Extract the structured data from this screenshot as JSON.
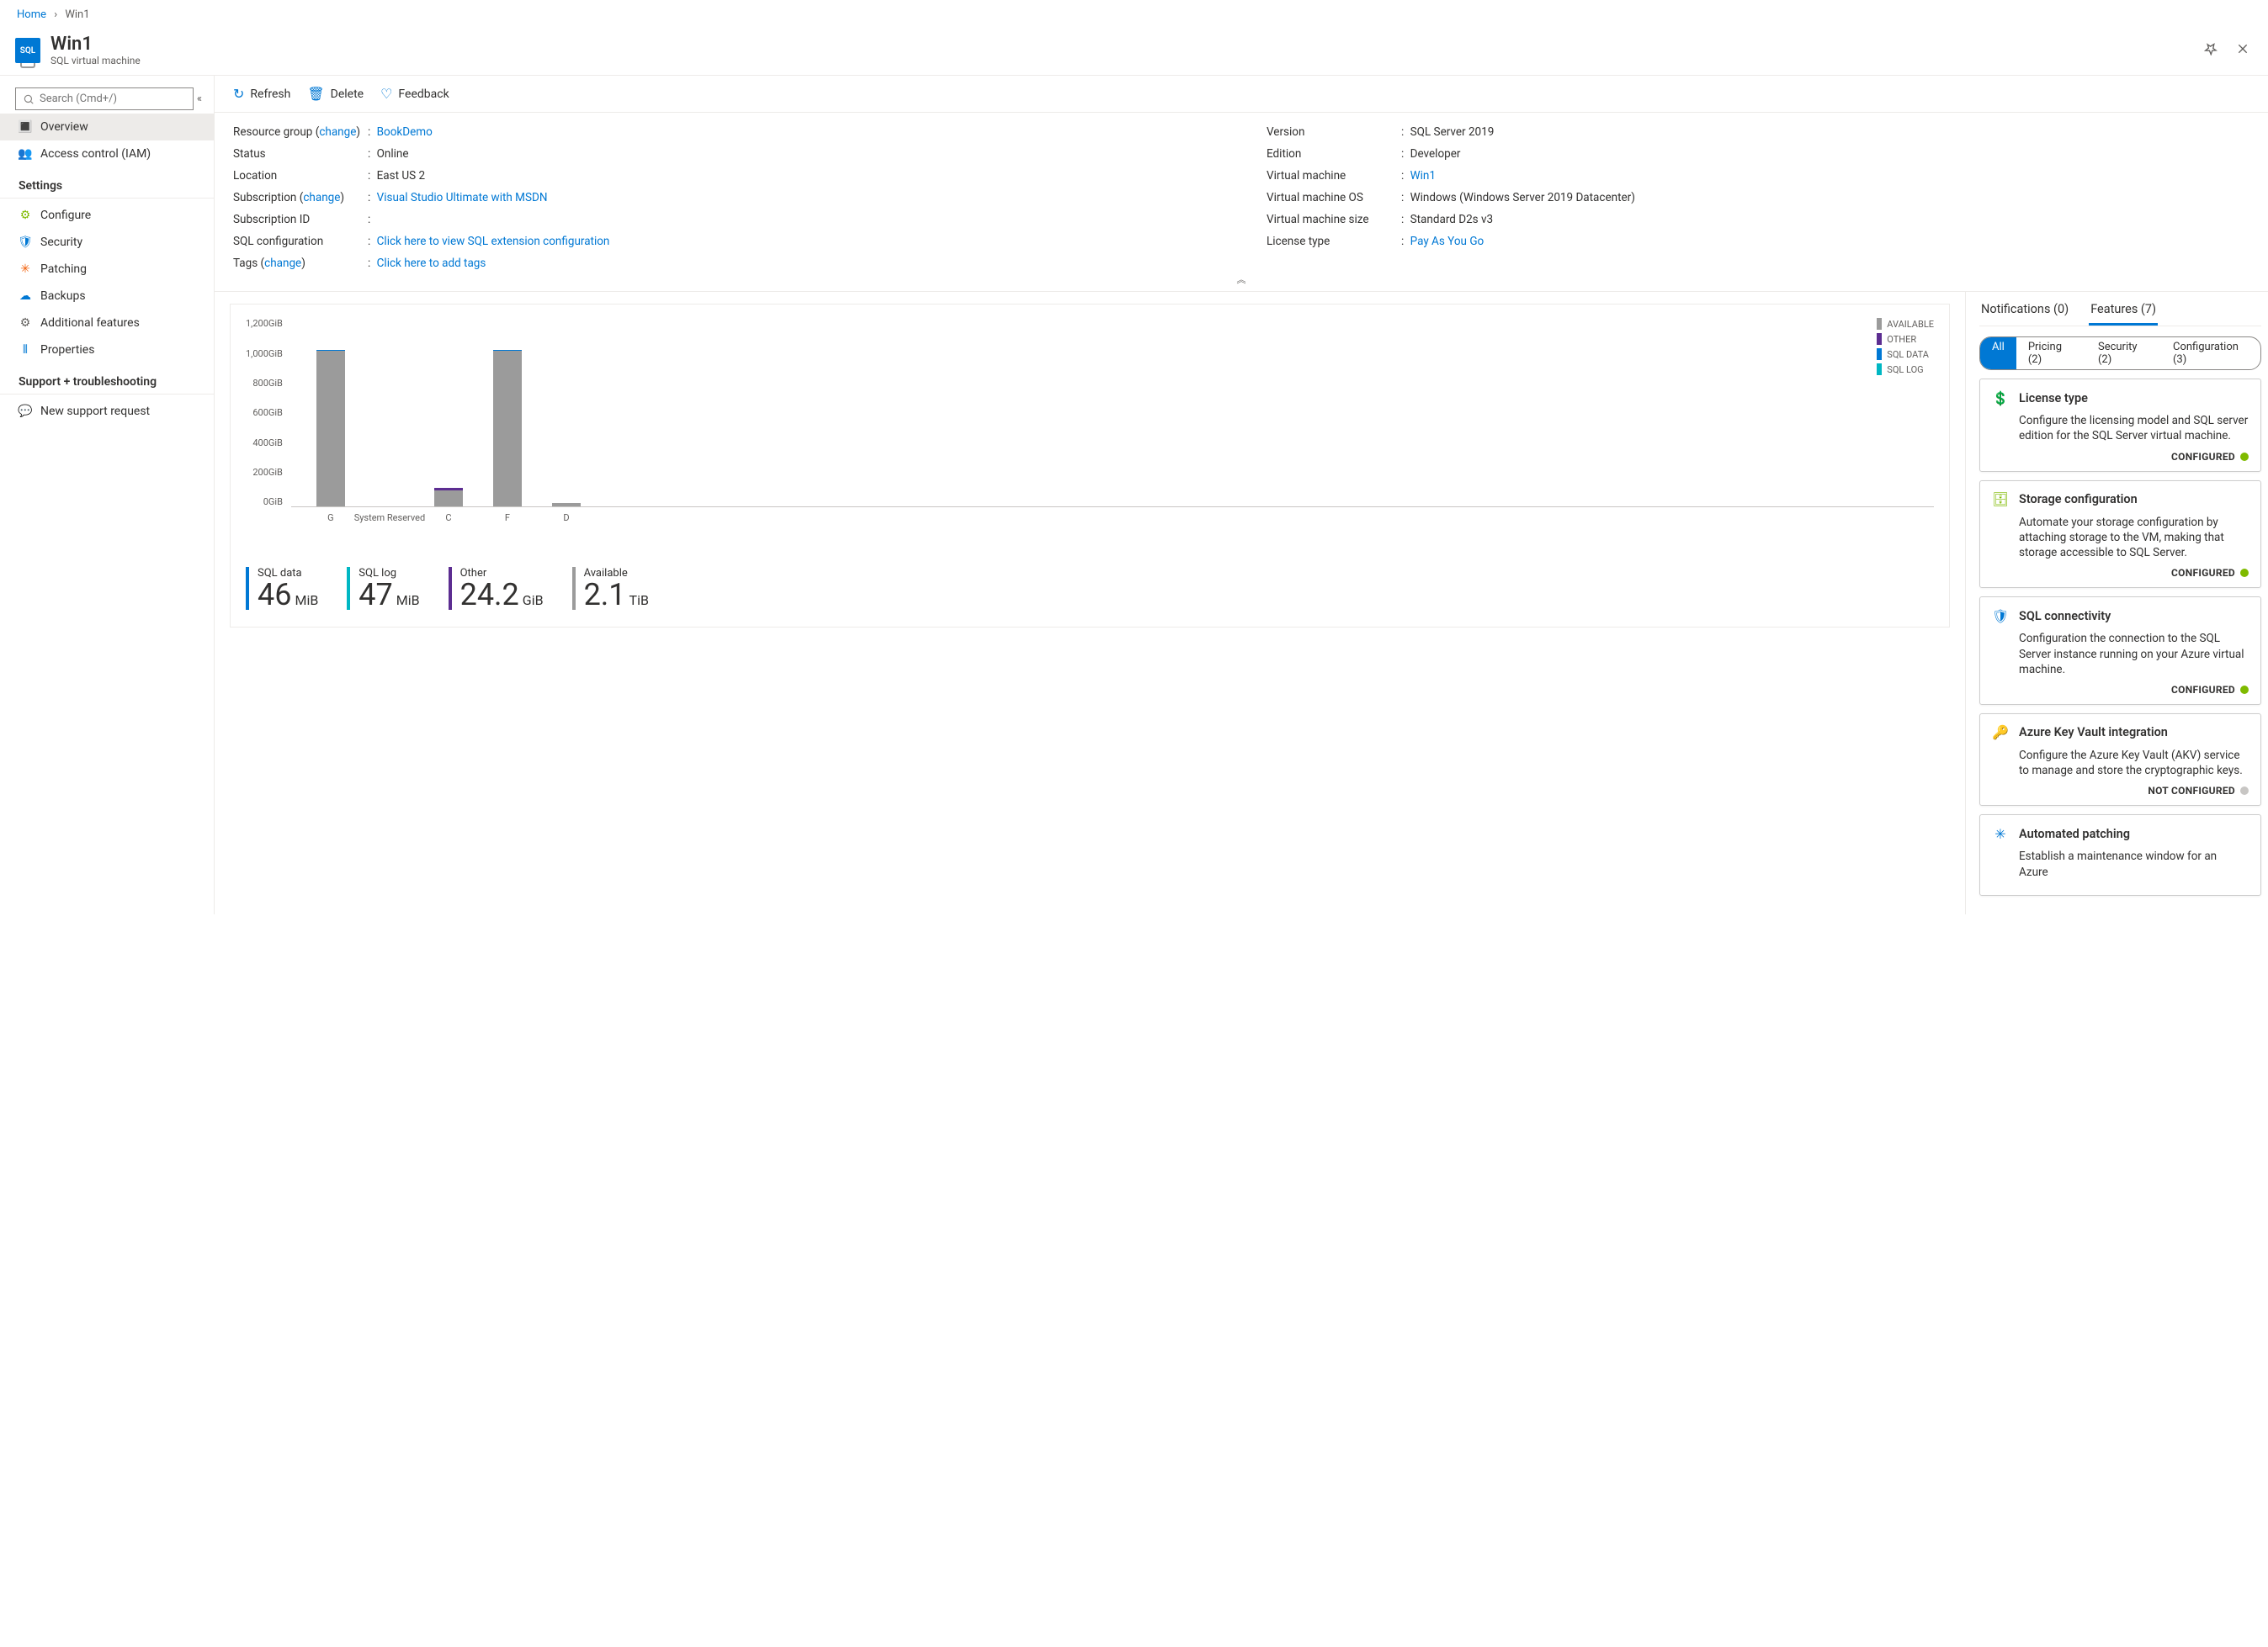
{
  "breadcrumb": {
    "home": "Home",
    "current": "Win1"
  },
  "header": {
    "title": "Win1",
    "subtitle": "SQL virtual machine"
  },
  "sidebar": {
    "search_placeholder": "Search (Cmd+/)",
    "items": [
      {
        "label": "Overview",
        "icon": "🔳",
        "color": "#0078d4",
        "active": true
      },
      {
        "label": "Access control (IAM)",
        "icon": "👥",
        "color": "#0078d4"
      }
    ],
    "settings_label": "Settings",
    "settings_items": [
      {
        "label": "Configure",
        "icon": "⚙",
        "color": "#7fba00"
      },
      {
        "label": "Security",
        "icon": "🛡",
        "color": "#0078d4"
      },
      {
        "label": "Patching",
        "icon": "✳",
        "color": "#f2610c"
      },
      {
        "label": "Backups",
        "icon": "☁",
        "color": "#0078d4"
      },
      {
        "label": "Additional features",
        "icon": "⚙",
        "color": "#605e5c"
      },
      {
        "label": "Properties",
        "icon": "⦀",
        "color": "#0078d4"
      }
    ],
    "support_label": "Support + troubleshooting",
    "support_items": [
      {
        "label": "New support request",
        "icon": "💬",
        "color": "#0078d4"
      }
    ]
  },
  "toolbar": {
    "refresh": "Refresh",
    "delete": "Delete",
    "feedback": "Feedback"
  },
  "essentials": {
    "left": [
      {
        "k": "Resource group",
        "change": "change",
        "v": "BookDemo",
        "link": true
      },
      {
        "k": "Status",
        "v": "Online"
      },
      {
        "k": "Location",
        "v": "East US 2"
      },
      {
        "k": "Subscription",
        "change": "change",
        "v": "Visual Studio Ultimate with MSDN",
        "link": true
      },
      {
        "k": "Subscription ID",
        "v": " "
      },
      {
        "k": "SQL configuration",
        "v": "Click here to view SQL extension configuration",
        "link": true
      },
      {
        "k": "Tags",
        "change": "change",
        "v": "Click here to add tags",
        "link": true
      }
    ],
    "right": [
      {
        "k": "Version",
        "v": "SQL Server 2019"
      },
      {
        "k": "Edition",
        "v": "Developer"
      },
      {
        "k": "Virtual machine",
        "v": "Win1",
        "link": true
      },
      {
        "k": "Virtual machine OS",
        "v": "Windows (Windows Server 2019 Datacenter)"
      },
      {
        "k": "Virtual machine size",
        "v": "Standard D2s v3"
      },
      {
        "k": "License type",
        "v": "Pay As You Go",
        "link": true
      }
    ]
  },
  "chart_data": {
    "type": "bar",
    "ylabel_unit": "GiB",
    "ylim": [
      0,
      1200
    ],
    "yticks": [
      "0GiB",
      "200GiB",
      "400GiB",
      "600GiB",
      "800GiB",
      "1,000GiB",
      "1,200GiB"
    ],
    "categories": [
      "G",
      "System Reserved",
      "C",
      "F",
      "D"
    ],
    "series": [
      {
        "name": "AVAILABLE",
        "color": "#9b9b9b",
        "values": [
          990,
          0,
          100,
          990,
          20
        ]
      },
      {
        "name": "OTHER",
        "color": "#5c2d91",
        "values": [
          0,
          0,
          18,
          0,
          0
        ]
      },
      {
        "name": "SQL DATA",
        "color": "#0078d4",
        "values": [
          2,
          0,
          0,
          2,
          0
        ]
      },
      {
        "name": "SQL LOG",
        "color": "#00b7c3",
        "values": [
          0,
          0,
          0,
          0,
          0
        ]
      }
    ],
    "legend": [
      "AVAILABLE",
      "OTHER",
      "SQL DATA",
      "SQL LOG"
    ]
  },
  "metrics": [
    {
      "label": "SQL data",
      "value": "46",
      "unit": "MiB",
      "color": "#0078d4"
    },
    {
      "label": "SQL log",
      "value": "47",
      "unit": "MiB",
      "color": "#00b7c3"
    },
    {
      "label": "Other",
      "value": "24.2",
      "unit": "GiB",
      "color": "#5c2d91"
    },
    {
      "label": "Available",
      "value": "2.1",
      "unit": "TiB",
      "color": "#9b9b9b"
    }
  ],
  "right_tabs": {
    "notifications": "Notifications (0)",
    "features": "Features (7)"
  },
  "pills": [
    {
      "label": "All",
      "active": true
    },
    {
      "label": "Pricing (2)"
    },
    {
      "label": "Security (2)"
    },
    {
      "label": "Configuration (3)"
    }
  ],
  "features": [
    {
      "icon": "💲",
      "color": "#7fba00",
      "title": "License type",
      "desc": "Configure the licensing model and SQL server edition for the SQL Server virtual machine.",
      "status": "CONFIGURED",
      "dot": "#7fba00"
    },
    {
      "icon": "🗄",
      "color": "#7fba00",
      "title": "Storage configuration",
      "desc": "Automate your storage configuration by attaching storage to the VM, making that storage accessible to SQL Server.",
      "status": "CONFIGURED",
      "dot": "#7fba00"
    },
    {
      "icon": "🛡",
      "color": "#0078d4",
      "title": "SQL connectivity",
      "desc": "Configuration the connection to the SQL Server instance running on your Azure virtual machine.",
      "status": "CONFIGURED",
      "dot": "#7fba00"
    },
    {
      "icon": "🔑",
      "color": "#ffb900",
      "title": "Azure Key Vault integration",
      "desc": "Configure the Azure Key Vault (AKV) service to manage and store the cryptographic keys.",
      "status": "NOT CONFIGURED",
      "dot": "#c8c6c4"
    },
    {
      "icon": "✳",
      "color": "#0078d4",
      "title": "Automated patching",
      "desc": "Establish a maintenance window for an Azure",
      "status": "",
      "dot": ""
    }
  ]
}
